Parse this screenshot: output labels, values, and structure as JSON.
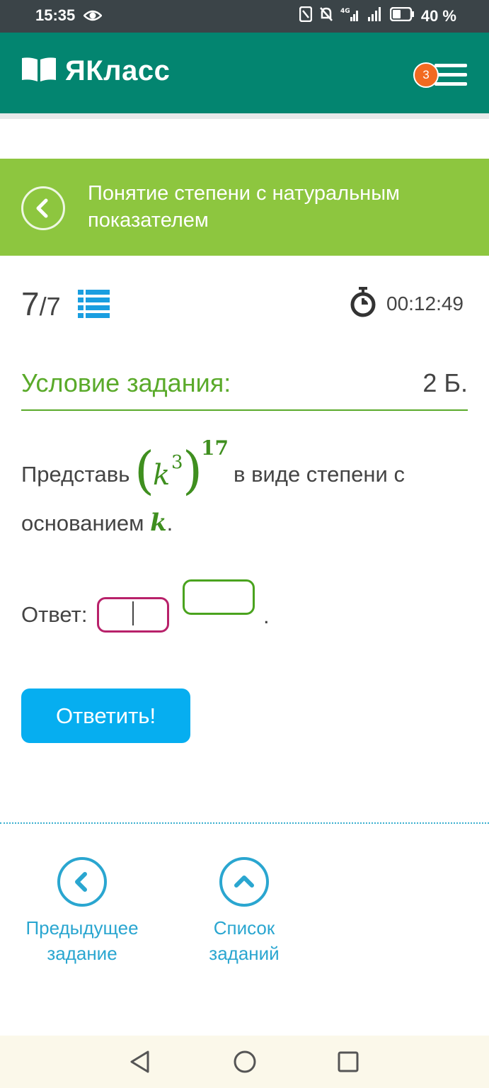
{
  "status_bar": {
    "time": "15:35",
    "battery": "40 %",
    "network": "4G"
  },
  "header": {
    "logo_text": "ЯКласс",
    "notification_count": "3",
    "brand_color": "#038570"
  },
  "topic": {
    "title": "Понятие степени с натуральным показателем",
    "bar_color": "#8dc63f"
  },
  "progress": {
    "current": "7",
    "total": "/7",
    "timer": "00:12:49"
  },
  "condition": {
    "title": "Условие задания:",
    "points": "2 Б."
  },
  "task": {
    "word_before": "Представь",
    "base": "k",
    "inner_exponent": "3",
    "outer_exponent": "17",
    "word_after": "в виде степени с",
    "word_line2": "основанием",
    "line2_var": "k",
    "line2_end": "."
  },
  "answer": {
    "label": "Ответ:",
    "base_value": "",
    "exponent_value": "",
    "end": "."
  },
  "submit": {
    "label": "Ответить!",
    "color": "#06aef0"
  },
  "bottom_nav": {
    "prev": {
      "line1": "Предыдущее",
      "line2": "задание"
    },
    "list": {
      "line1": "Список",
      "line2": "заданий"
    }
  }
}
